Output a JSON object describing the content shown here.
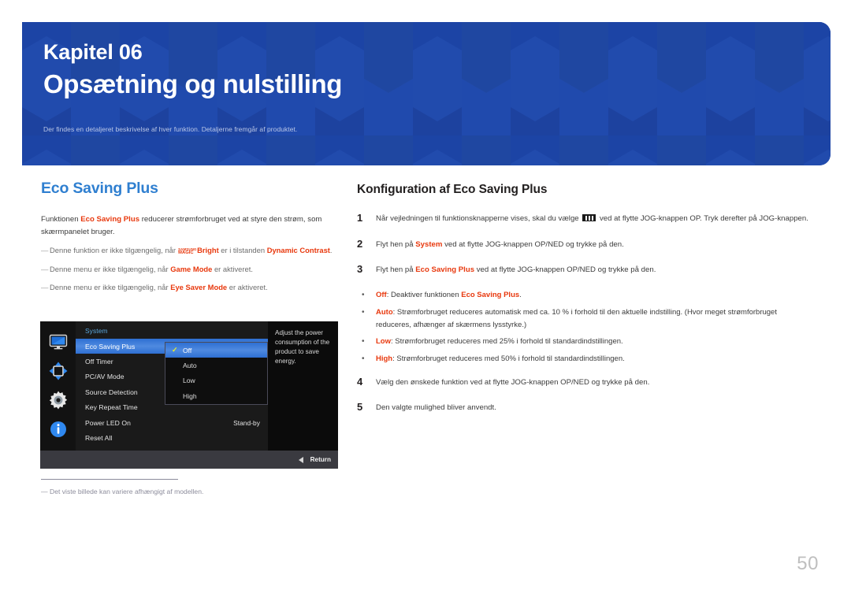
{
  "banner": {
    "chapter_label": "Kapitel 06",
    "chapter_title": "Opsætning og nulstilling",
    "subtitle": "Der findes en detaljeret beskrivelse af hver funktion. Detaljerne fremgår af produktet.",
    "bg_color": "#1c44a5",
    "title_color": "#ffffff",
    "subtitle_color": "#b9c6e6"
  },
  "left": {
    "heading": "Eco Saving Plus",
    "heading_color": "#2f7fd0",
    "intro_prefix": "Funktionen ",
    "intro_bold": "Eco Saving Plus",
    "intro_suffix": " reducerer strømforbruget ved at styre den strøm, som skærmpanelet bruger.",
    "notes": [
      {
        "dash": "―",
        "pre": "Denne funktion er ikke tilgængelig, når ",
        "logo_top": "SAMSUNG",
        "logo_bottom": "MAGIC",
        "bold1": "Bright",
        "mid": " er i tilstanden ",
        "bold2": "Dynamic Contrast",
        "post": "."
      },
      {
        "dash": "―",
        "pre": "Denne menu er ikke tilgængelig, når ",
        "bold1": "Game Mode",
        "post": " er aktiveret."
      },
      {
        "dash": "―",
        "pre": "Denne menu er ikke tilgængelig, når ",
        "bold1": "Eye Saver Mode",
        "post": " er aktiveret."
      }
    ],
    "footnote_dash": "―",
    "footnote_text": "Det viste billede kan variere afhængigt af modellen."
  },
  "osd": {
    "sidebar_icons": [
      {
        "name": "monitor-icon"
      },
      {
        "name": "arrows-move-icon"
      },
      {
        "name": "gear-icon"
      },
      {
        "name": "info-icon"
      }
    ],
    "menu_title": "System",
    "menu_title_color": "#5aa8e0",
    "rows": [
      {
        "label": "Eco Saving Plus",
        "value": "",
        "selected": true
      },
      {
        "label": "Off Timer",
        "value": "",
        "selected": false
      },
      {
        "label": "PC/AV Mode",
        "value": "",
        "selected": false
      },
      {
        "label": "Source Detection",
        "value": "",
        "selected": false
      },
      {
        "label": "Key Repeat Time",
        "value": "",
        "selected": false
      },
      {
        "label": "Power LED On",
        "value": "Stand-by",
        "selected": false
      },
      {
        "label": "Reset All",
        "value": "",
        "selected": false
      }
    ],
    "submenu": [
      {
        "label": "Off",
        "checked": true,
        "selected": true
      },
      {
        "label": "Auto",
        "checked": false,
        "selected": false
      },
      {
        "label": "Low",
        "checked": false,
        "selected": false
      },
      {
        "label": "High",
        "checked": false,
        "selected": false
      }
    ],
    "help_text": "Adjust the power consumption of the product to save energy.",
    "footer_label": "Return",
    "highlight_color": "#3f7fd8"
  },
  "right": {
    "heading": "Konfiguration af Eco Saving Plus",
    "steps": [
      {
        "num": "1",
        "pre": "Når vejledningen til funktionsknapperne vises, skal du vælge ",
        "icon": "keypad-icon",
        "post": " ved at flytte JOG-knappen OP. Tryk derefter på JOG-knappen."
      },
      {
        "num": "2",
        "pre": "Flyt hen på ",
        "bold": "System",
        "post": " ved at flytte JOG-knappen OP/NED og trykke på den."
      },
      {
        "num": "3",
        "pre": "Flyt hen på ",
        "bold": "Eco Saving Plus",
        "post": " ved at flytte JOG-knappen OP/NED og trykke på den."
      },
      {
        "num": "4",
        "pre": "Vælg den ønskede funktion ved at flytte JOG-knappen OP/NED og trykke på den.",
        "post": ""
      },
      {
        "num": "5",
        "pre": "Den valgte mulighed bliver anvendt.",
        "post": ""
      }
    ],
    "bullets": [
      {
        "dot": "•",
        "bold": "Off",
        "mid": ": Deaktiver funktionen ",
        "bold2": "Eco Saving Plus",
        "post": "."
      },
      {
        "dot": "•",
        "bold": "Auto",
        "mid": ": Strømforbruget reduceres automatisk med ca. 10 % i forhold til den aktuelle indstilling. (Hvor meget strømforbruget reduceres, afhænger af skærmens lysstyrke.)",
        "post": ""
      },
      {
        "dot": "•",
        "bold": "Low",
        "mid": ": Strømforbruget reduceres med 25% i forhold til standardindstillingen.",
        "post": ""
      },
      {
        "dot": "•",
        "bold": "High",
        "mid": ": Strømforbruget reduceres med 50% i forhold til standardindstillingen.",
        "post": ""
      }
    ]
  },
  "page_number": "50"
}
